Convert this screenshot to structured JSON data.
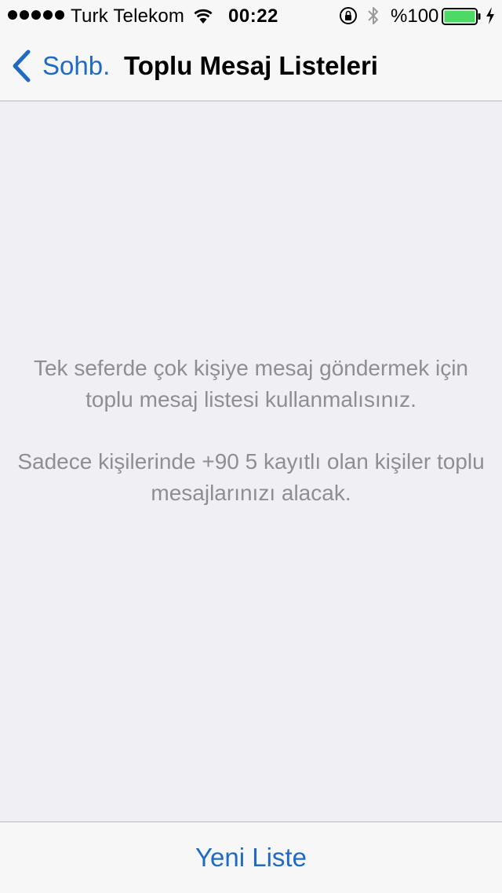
{
  "status_bar": {
    "carrier": "Turk Telekom",
    "time": "00:22",
    "battery_percent": "%100",
    "battery_level": 1.0,
    "signal_bars": 5,
    "icons": [
      "wifi-icon",
      "rotation-lock-icon",
      "bluetooth-icon",
      "battery-icon",
      "charging-icon"
    ]
  },
  "nav": {
    "back_label": "Sohb.",
    "back_icon": "chevron-left-icon",
    "title": "Toplu Mesaj Listeleri"
  },
  "main": {
    "info_line1": "Tek seferde çok kişiye mesaj göndermek için toplu mesaj listesi kullanmalısınız.",
    "info_line2": "Sadece kişilerinde +90 5 kayıtlı olan kişiler toplu mesajlarınızı alacak."
  },
  "toolbar": {
    "new_list_label": "Yeni Liste"
  },
  "colors": {
    "accent": "#1f6bc4",
    "background": "#efeff4",
    "bar_background": "#f7f7f7",
    "secondary_text": "#8e8e93",
    "battery_fill": "#4cd964"
  }
}
